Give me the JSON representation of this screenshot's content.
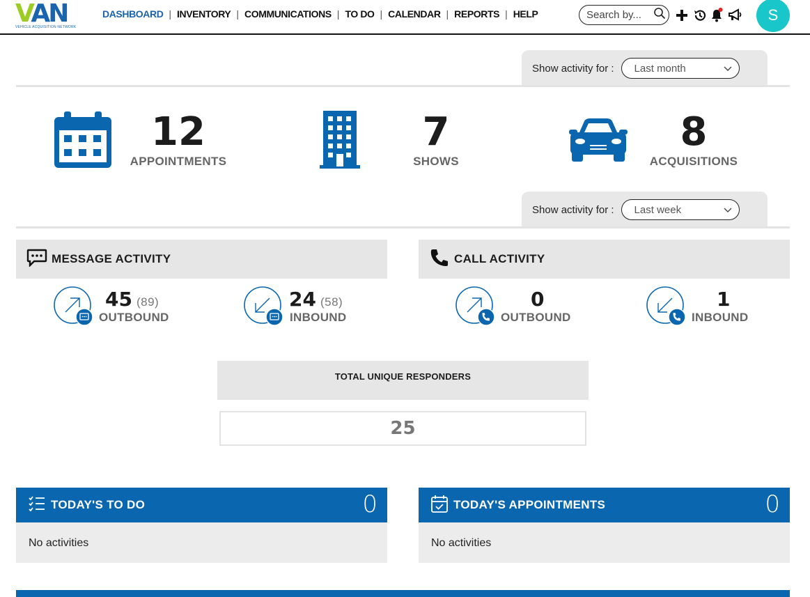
{
  "logo": {
    "main_v": "V",
    "main_rest": "AN",
    "sub": "VEHICLE ACQUISITION NETWORK"
  },
  "nav": {
    "items": [
      {
        "label": "DASHBOARD",
        "active": true
      },
      {
        "label": "INVENTORY"
      },
      {
        "label": "COMMUNICATIONS"
      },
      {
        "label": "TO DO"
      },
      {
        "label": "CALENDAR"
      },
      {
        "label": "REPORTS"
      },
      {
        "label": "HELP"
      }
    ],
    "separator": "|"
  },
  "search": {
    "placeholder": "Search by..."
  },
  "toolbar_icons": [
    "plus-icon",
    "history-icon",
    "bell-icon",
    "megaphone-icon"
  ],
  "user": {
    "initial": "S"
  },
  "filter_top": {
    "label": "Show activity for :",
    "value": "Last month"
  },
  "stats": {
    "appointments": {
      "value": "12",
      "label": "APPOINTMENTS"
    },
    "shows": {
      "value": "7",
      "label": "SHOWS"
    },
    "acquisitions": {
      "value": "8",
      "label": "ACQUISITIONS"
    }
  },
  "filter_bottom": {
    "label": "Show activity for :",
    "value": "Last week"
  },
  "message_activity": {
    "title": "MESSAGE ACTIVITY",
    "outbound": {
      "value": "45",
      "sub": "(89)",
      "label": "OUTBOUND"
    },
    "inbound": {
      "value": "24",
      "sub": "(58)",
      "label": "INBOUND"
    }
  },
  "call_activity": {
    "title": "CALL ACTIVITY",
    "outbound": {
      "value": "0",
      "label": "OUTBOUND"
    },
    "inbound": {
      "value": "1",
      "label": "INBOUND"
    }
  },
  "total_unique_responders": {
    "title": "TOTAL UNIQUE RESPONDERS",
    "value": "25"
  },
  "todays_todo": {
    "title": "TODAY'S TO DO",
    "count": "0",
    "empty": "No activities"
  },
  "todays_appointments": {
    "title": "TODAY'S APPOINTMENTS",
    "count": "0",
    "empty": "No activities"
  },
  "colors": {
    "brand_blue": "#0a66ae",
    "accent_green": "#9ccc25",
    "avatar": "#19c6c9",
    "notify": "#e32222"
  }
}
